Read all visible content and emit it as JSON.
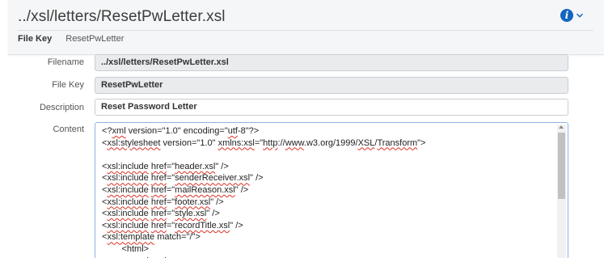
{
  "header": {
    "title": "../xsl/letters/ResetPwLetter.xsl",
    "file_key_label": "File Key",
    "file_key_value": "ResetPwLetter",
    "info_icon": "info-icon",
    "dropdown_icon": "chevron-down-icon",
    "accent_color": "#1565c0"
  },
  "form": {
    "filename": {
      "label": "Filename",
      "value": "../xsl/letters/ResetPwLetter.xsl"
    },
    "file_key": {
      "label": "File Key",
      "value": "ResetPwLetter"
    },
    "description": {
      "label": "Description",
      "value": "Reset Password Letter"
    },
    "content": {
      "label": "Content",
      "lines": [
        [
          {
            "t": "<?"
          },
          {
            "t": "xml",
            "u": true
          },
          {
            "t": " version=\"1.0\" encoding=\""
          },
          {
            "t": "utf",
            "u": true
          },
          {
            "t": "-8\"?>"
          }
        ],
        [
          {
            "t": "<"
          },
          {
            "t": "xsl:stylesheet",
            "u": true
          },
          {
            "t": " version=\"1.0\" "
          },
          {
            "t": "xmlns:xsl",
            "u": true
          },
          {
            "t": "=\""
          },
          {
            "t": "http",
            "u": true
          },
          {
            "t": "://"
          },
          {
            "t": "www",
            "u": true
          },
          {
            "t": ".w3.org/1999/"
          },
          {
            "t": "XSL",
            "u": true
          },
          {
            "t": "/"
          },
          {
            "t": "Transform",
            "u": true
          },
          {
            "t": "\">"
          }
        ],
        [],
        [
          {
            "t": "<"
          },
          {
            "t": "xsl:include",
            "u": true
          },
          {
            "t": " "
          },
          {
            "t": "href",
            "u": true
          },
          {
            "t": "=\""
          },
          {
            "t": "header.xsl",
            "u": true
          },
          {
            "t": "\" />"
          }
        ],
        [
          {
            "t": "<"
          },
          {
            "t": "xsl:include",
            "u": true
          },
          {
            "t": " "
          },
          {
            "t": "href",
            "u": true
          },
          {
            "t": "=\""
          },
          {
            "t": "senderReceiver.xsl",
            "u": true
          },
          {
            "t": "\" />"
          }
        ],
        [
          {
            "t": "<"
          },
          {
            "t": "xsl:include",
            "u": true
          },
          {
            "t": " "
          },
          {
            "t": "href",
            "u": true
          },
          {
            "t": "=\""
          },
          {
            "t": "mailReason.xsl",
            "u": true
          },
          {
            "t": "\" />"
          }
        ],
        [
          {
            "t": "<"
          },
          {
            "t": "xsl:include",
            "u": true
          },
          {
            "t": " "
          },
          {
            "t": "href",
            "u": true
          },
          {
            "t": "=\""
          },
          {
            "t": "footer.xsl",
            "u": true
          },
          {
            "t": "\" />"
          }
        ],
        [
          {
            "t": "<"
          },
          {
            "t": "xsl:include",
            "u": true
          },
          {
            "t": " "
          },
          {
            "t": "href",
            "u": true
          },
          {
            "t": "=\""
          },
          {
            "t": "style.xsl",
            "u": true
          },
          {
            "t": "\" />"
          }
        ],
        [
          {
            "t": "<"
          },
          {
            "t": "xsl:include",
            "u": true
          },
          {
            "t": " "
          },
          {
            "t": "href",
            "u": true
          },
          {
            "t": "=\""
          },
          {
            "t": "recordTitle.xsl",
            "u": true
          },
          {
            "t": "\" />"
          }
        ],
        [
          {
            "t": "<"
          },
          {
            "t": "xsl:template",
            "u": true
          },
          {
            "t": " match=\"/\">"
          }
        ],
        [
          {
            "t": "        <html>"
          }
        ],
        [
          {
            "t": "                <head>"
          }
        ]
      ]
    }
  }
}
